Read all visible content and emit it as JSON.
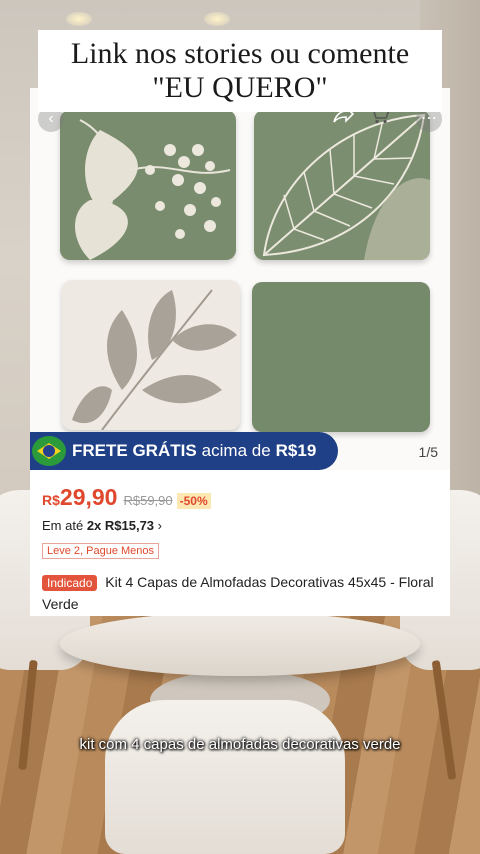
{
  "caption": {
    "line1": "Link nos stories ou comente",
    "line2": "\"EU QUERO\""
  },
  "product": {
    "gallery": {
      "page_indicator": "1/5",
      "icons": [
        "back-arrow-icon",
        "share-icon",
        "cart-icon",
        "more-icon"
      ]
    },
    "shipping_banner": {
      "bold": "FRETE GRÁTIS",
      "middle": "acima de",
      "threshold": "R$19"
    },
    "price": {
      "currency": "R$",
      "current": "29,90",
      "original": "R$59,90",
      "discount": "-50%"
    },
    "installment": {
      "prefix": "Em até",
      "value": "2x R$15,73",
      "chevron": "›"
    },
    "promo_tag": "Leve 2, Pague Menos",
    "badge": "Indicado",
    "title": "Kit 4 Capas de Almofadas Decorativas 45x45 - Floral Verde"
  },
  "subtitle": "kit com 4 capas de almofadas decorativas verde",
  "colors": {
    "price_red": "#e0482d",
    "banner_blue": "#1f3f86",
    "sage_green": "#7a8c6e"
  }
}
